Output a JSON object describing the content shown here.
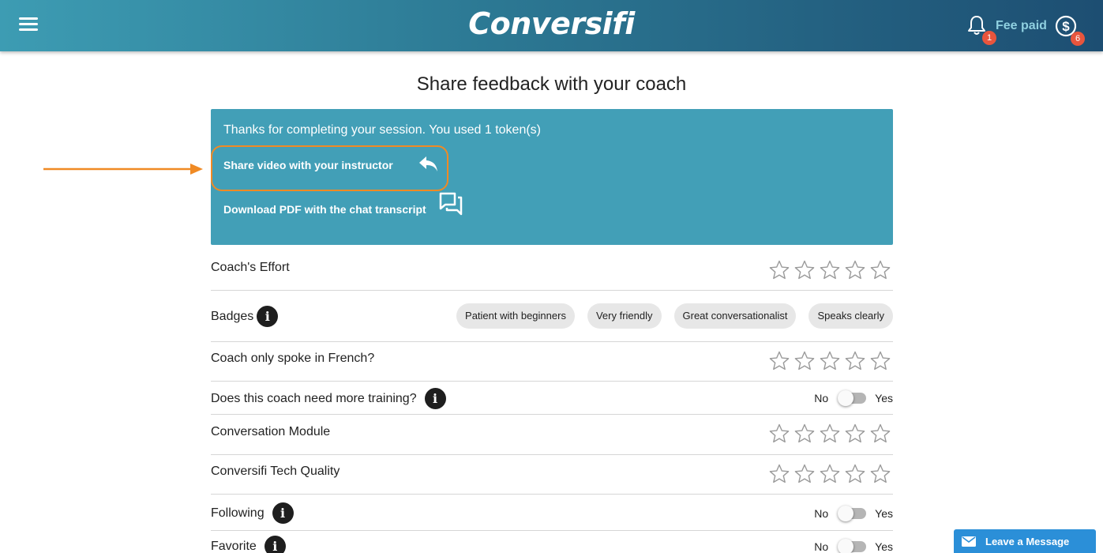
{
  "header": {
    "logo_text": "Conversifi",
    "fee_label": "Fee paid",
    "notifications_count": "1",
    "tokens_count": "6",
    "menu_icon": "hamburger-menu-icon",
    "bell_icon": "bell-icon",
    "coin_icon": "dollar-coin-icon"
  },
  "page": {
    "title": "Share feedback with your coach"
  },
  "panel": {
    "message": "Thanks for completing your session. You used 1 token(s)",
    "share_label": "Share video with your instructor",
    "download_label": "Download PDF with the chat transcript",
    "share_icon": "reply-arrow-icon",
    "download_icon": "chat-bubbles-icon",
    "color": "#429fb7"
  },
  "annotation": {
    "highlight_color": "#f08a24"
  },
  "feedback": {
    "coach_effort": {
      "label": "Coach's Effort",
      "rating": 0
    },
    "badges": {
      "label": "Badges",
      "items": [
        "Patient with beginners",
        "Very friendly",
        "Great conversationalist",
        "Speaks clearly"
      ]
    },
    "french_only": {
      "label": "Coach only spoke in French?",
      "rating": 0
    },
    "more_training": {
      "label": "Does this coach need more training?",
      "no": "No",
      "yes": "Yes",
      "value": false
    },
    "conversation_module": {
      "label": "Conversation Module",
      "rating": 0
    },
    "tech_quality": {
      "label": "Conversifi Tech Quality",
      "rating": 0
    },
    "following": {
      "label": "Following",
      "no": "No",
      "yes": "Yes",
      "value": false
    },
    "favorite": {
      "label": "Favorite",
      "no": "No",
      "yes": "Yes",
      "value": false
    }
  },
  "chat_widget": {
    "label": "Leave a Message",
    "icon": "mail-icon",
    "color": "#2b8fd8"
  }
}
